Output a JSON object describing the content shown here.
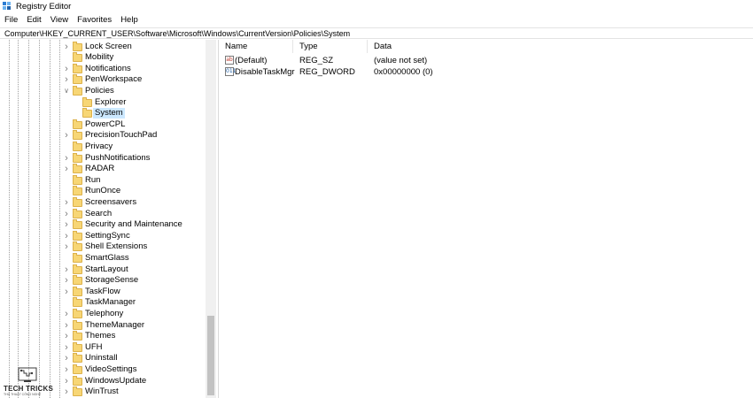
{
  "window": {
    "title": "Registry Editor",
    "icon": "registry-editor-icon"
  },
  "menu": [
    "File",
    "Edit",
    "View",
    "Favorites",
    "Help"
  ],
  "address": "Computer\\HKEY_CURRENT_USER\\Software\\Microsoft\\Windows\\CurrentVersion\\Policies\\System",
  "tree": [
    {
      "label": "Lock Screen",
      "level": 0,
      "chevron": "right",
      "selected": false
    },
    {
      "label": "Mobility",
      "level": 0,
      "chevron": "none",
      "selected": false
    },
    {
      "label": "Notifications",
      "level": 0,
      "chevron": "right",
      "selected": false
    },
    {
      "label": "PenWorkspace",
      "level": 0,
      "chevron": "right",
      "selected": false
    },
    {
      "label": "Policies",
      "level": 0,
      "chevron": "down",
      "selected": false
    },
    {
      "label": "Explorer",
      "level": 1,
      "chevron": "none",
      "selected": false
    },
    {
      "label": "System",
      "level": 1,
      "chevron": "none",
      "selected": true
    },
    {
      "label": "PowerCPL",
      "level": 0,
      "chevron": "none",
      "selected": false
    },
    {
      "label": "PrecisionTouchPad",
      "level": 0,
      "chevron": "right",
      "selected": false
    },
    {
      "label": "Privacy",
      "level": 0,
      "chevron": "none",
      "selected": false
    },
    {
      "label": "PushNotifications",
      "level": 0,
      "chevron": "right",
      "selected": false
    },
    {
      "label": "RADAR",
      "level": 0,
      "chevron": "right",
      "selected": false
    },
    {
      "label": "Run",
      "level": 0,
      "chevron": "none",
      "selected": false
    },
    {
      "label": "RunOnce",
      "level": 0,
      "chevron": "none",
      "selected": false
    },
    {
      "label": "Screensavers",
      "level": 0,
      "chevron": "right",
      "selected": false
    },
    {
      "label": "Search",
      "level": 0,
      "chevron": "right",
      "selected": false
    },
    {
      "label": "Security and Maintenance",
      "level": 0,
      "chevron": "right",
      "selected": false
    },
    {
      "label": "SettingSync",
      "level": 0,
      "chevron": "right",
      "selected": false
    },
    {
      "label": "Shell Extensions",
      "level": 0,
      "chevron": "right",
      "selected": false
    },
    {
      "label": "SmartGlass",
      "level": 0,
      "chevron": "none",
      "selected": false
    },
    {
      "label": "StartLayout",
      "level": 0,
      "chevron": "right",
      "selected": false
    },
    {
      "label": "StorageSense",
      "level": 0,
      "chevron": "right",
      "selected": false
    },
    {
      "label": "TaskFlow",
      "level": 0,
      "chevron": "right",
      "selected": false
    },
    {
      "label": "TaskManager",
      "level": 0,
      "chevron": "none",
      "selected": false
    },
    {
      "label": "Telephony",
      "level": 0,
      "chevron": "right",
      "selected": false
    },
    {
      "label": "ThemeManager",
      "level": 0,
      "chevron": "right",
      "selected": false
    },
    {
      "label": "Themes",
      "level": 0,
      "chevron": "right",
      "selected": false
    },
    {
      "label": "UFH",
      "level": 0,
      "chevron": "right",
      "selected": false
    },
    {
      "label": "Uninstall",
      "level": 0,
      "chevron": "right",
      "selected": false
    },
    {
      "label": "VideoSettings",
      "level": 0,
      "chevron": "right",
      "selected": false
    },
    {
      "label": "WindowsUpdate",
      "level": 0,
      "chevron": "right",
      "selected": false
    },
    {
      "label": "WinTrust",
      "level": 0,
      "chevron": "right",
      "selected": false
    }
  ],
  "columns": [
    "Name",
    "Type",
    "Data"
  ],
  "values": [
    {
      "name": "(Default)",
      "type": "REG_SZ",
      "data": "(value not set)",
      "icon": "string-value-icon",
      "glyph": "ab"
    },
    {
      "name": "DisableTaskMgr",
      "type": "REG_DWORD",
      "data": "0x00000000 (0)",
      "icon": "binary-value-icon",
      "glyph": "011"
    }
  ],
  "watermark": {
    "text": "TECH TRICKS",
    "sub": "THỦ THUẬT CÔNG NGHỆ"
  },
  "colors": {
    "selection": "#cce8ff",
    "folder": "#f7d675",
    "folder_border": "#dcb14b"
  }
}
